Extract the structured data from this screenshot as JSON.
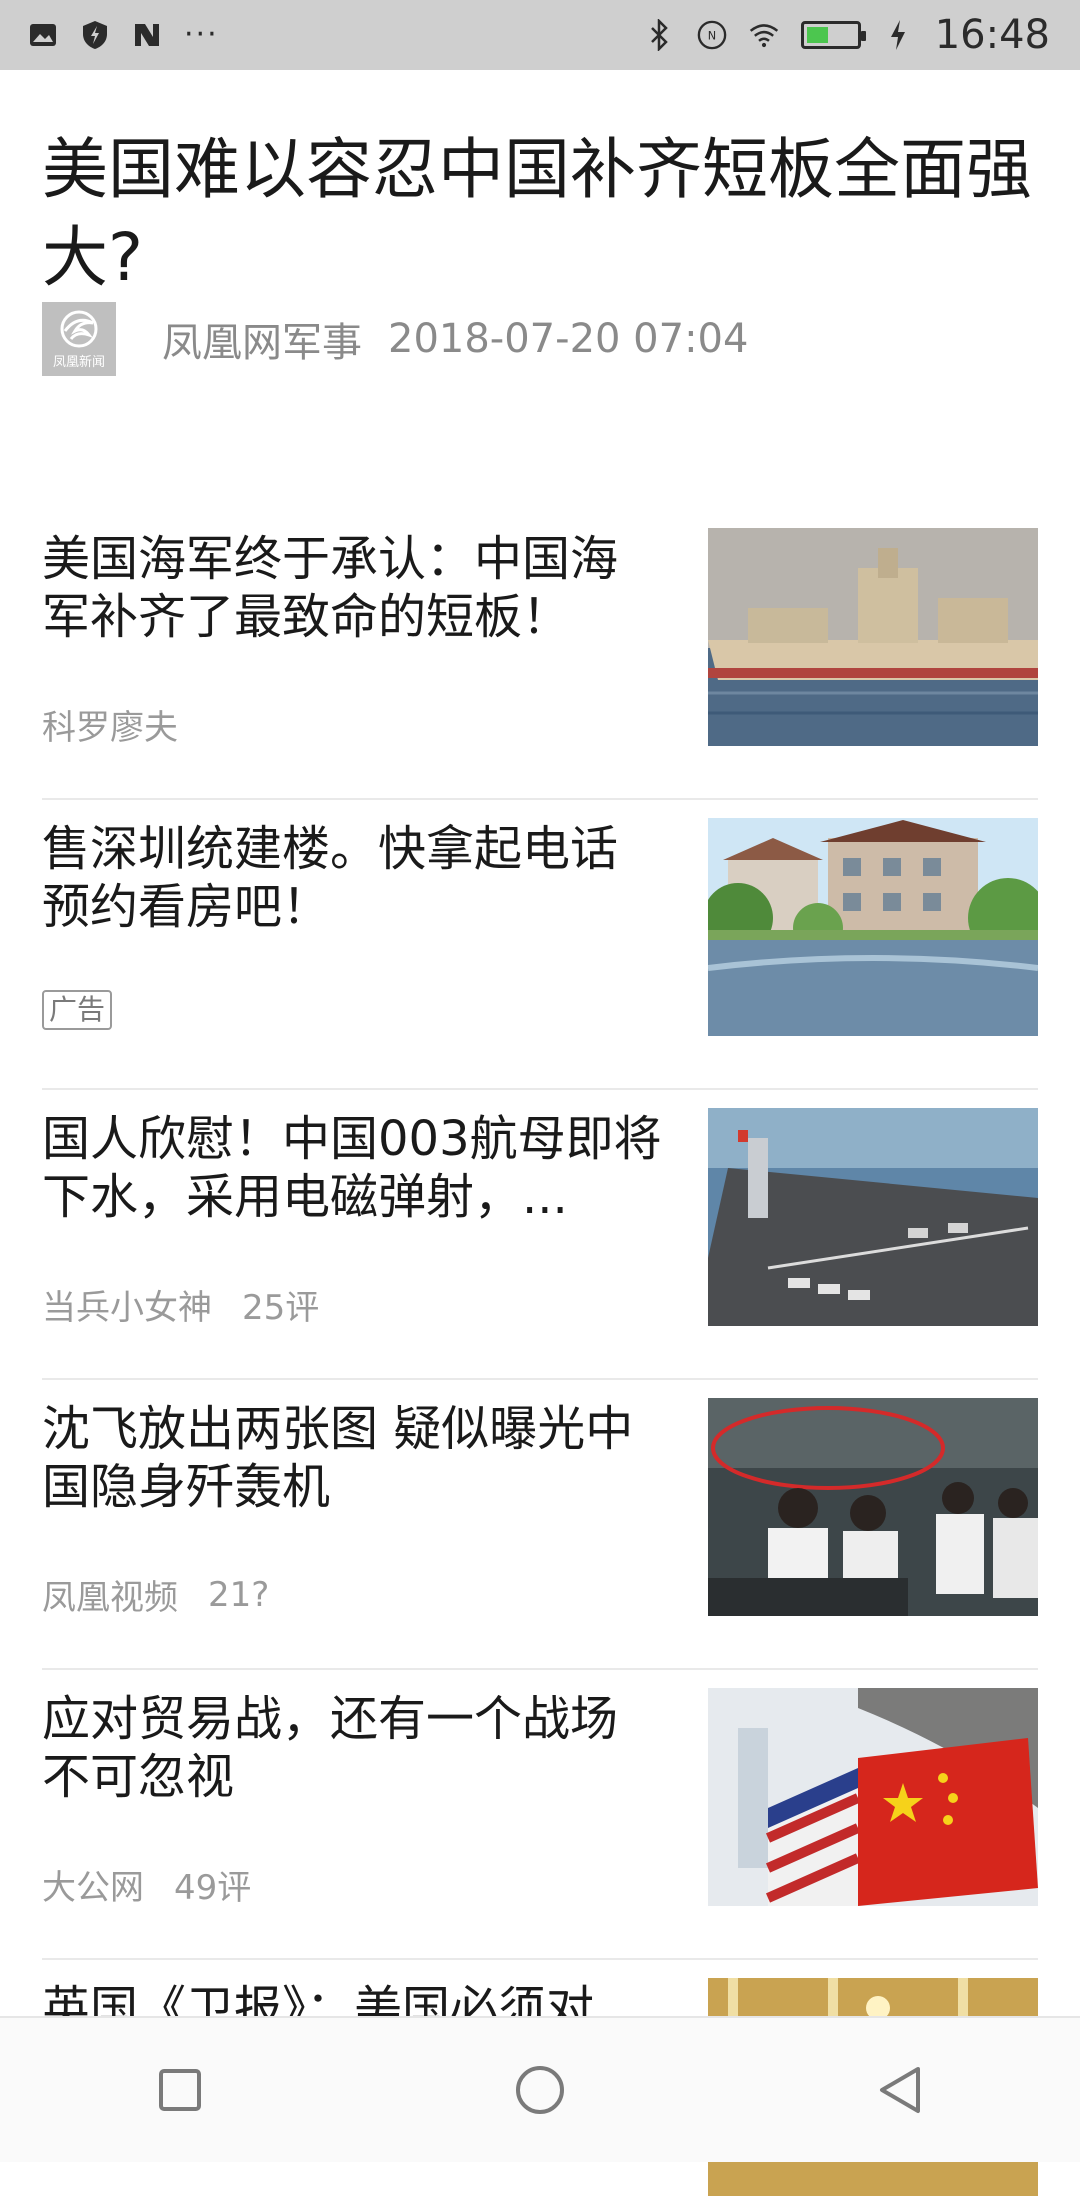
{
  "status_bar": {
    "time": "16:48",
    "left_icons": [
      "image-icon",
      "shield-icon",
      "n-icon"
    ],
    "more": "···",
    "right_icons": [
      "bluetooth-icon",
      "nfc-icon",
      "wifi-icon",
      "battery-icon",
      "charging-icon"
    ],
    "battery_level": 0.45
  },
  "article": {
    "title": "美国难以容忍中国补齐短板全面强大?",
    "source": "凤凰网军事",
    "datetime": "2018-07-20 07:04",
    "logo_text": "凤凰新闻"
  },
  "news": [
    {
      "title": "美国海军终于承认：中国海军补齐了最致命的短板！",
      "source": "科罗廖夫",
      "comments": ""
    },
    {
      "title": "售深圳统建楼。快拿起电话预约看房吧！",
      "source": "",
      "comments": "",
      "ad": "广告"
    },
    {
      "title": "国人欣慰！中国003航母即将下水，采用电磁弹射，...",
      "source": "当兵小女神",
      "comments": "25评"
    },
    {
      "title": "沈飞放出两张图 疑似曝光中国隐身歼轰机",
      "source": "凤凰视频",
      "comments": "21?"
    },
    {
      "title": "应对贸易战，还有一个战场不可忽视",
      "source": "大公网",
      "comments": "49评"
    },
    {
      "title": "英国《卫报》：美国必须对",
      "source": "",
      "comments": ""
    }
  ],
  "colors": {
    "status_bar_bg": "#cfcfcf",
    "battery_fill": "#4cc64f",
    "meta_text": "#8a8a8a"
  }
}
